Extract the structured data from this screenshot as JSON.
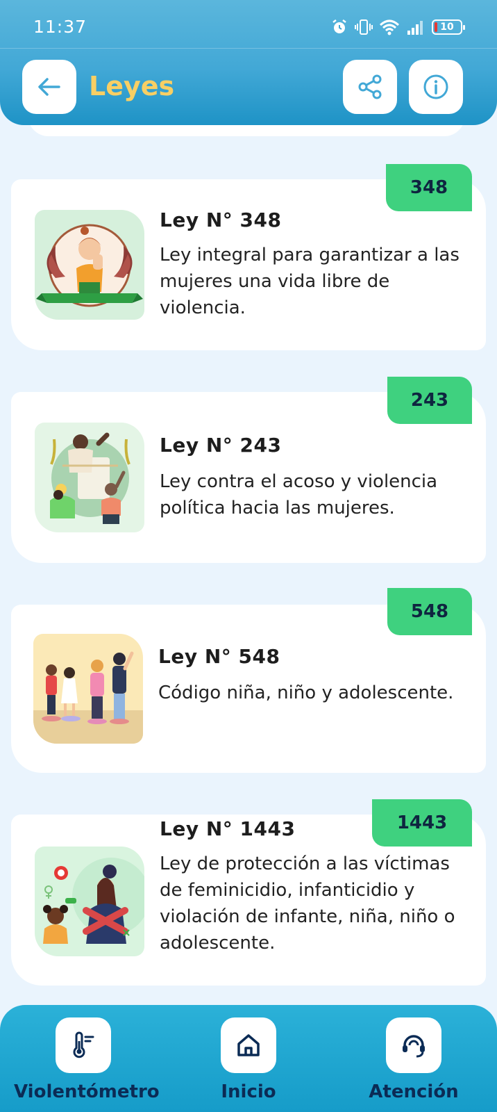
{
  "status_bar": {
    "time": "11:37",
    "battery": "10",
    "icons": [
      "alarm-icon",
      "vibrate-icon",
      "wifi-icon",
      "signal-icon",
      "battery-icon"
    ]
  },
  "header": {
    "title": "Leyes",
    "back_icon": "arrow-left-icon",
    "share_icon": "share-icon",
    "info_icon": "info-icon"
  },
  "laws": [
    {
      "badge": "348",
      "title": "Ley N° 348",
      "description": "Ley integral para garantizar a las mujeres una vida libre de violencia."
    },
    {
      "badge": "243",
      "title": "Ley N° 243",
      "description": "Ley contra el acoso y violencia política hacia las mujeres."
    },
    {
      "badge": "548",
      "title": "Ley N° 548",
      "description": "Código niña, niño y adolescente."
    },
    {
      "badge": "1443",
      "title": "Ley N° 1443",
      "description": "Ley de protección a las víctimas de feminicidio, infanticidio y violación de infante, niña, niño o adolescente."
    }
  ],
  "bottom_nav": [
    {
      "label": "Violentómetro",
      "icon": "thermometer-icon"
    },
    {
      "label": "Inicio",
      "icon": "home-icon"
    },
    {
      "label": "Atención",
      "icon": "headset-icon"
    }
  ],
  "colors": {
    "header": "#42a8d6",
    "title": "#f8cf64",
    "badge": "#3fd17f",
    "nav_text": "#0b2b55",
    "background": "#eaf4fd"
  }
}
